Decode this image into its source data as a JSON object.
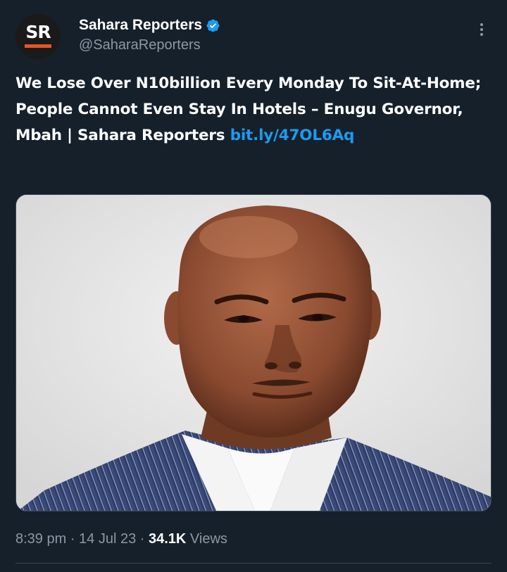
{
  "account": {
    "avatar_text": "SR",
    "display_name": "Sahara Reporters",
    "handle": "@SaharaReporters",
    "verified_icon": "verified-badge-icon",
    "verified_color": "#1d9bf0"
  },
  "tweet": {
    "text": "We Lose Over N10billion Every Monday To Sit-At-Home; People Cannot Even Stay In Hotels – Enugu Governor, Mbah  | Sahara Reporters ",
    "link": "bit.ly/47OL6Aq",
    "media_icon": "photo-portrait"
  },
  "meta": {
    "time": "8:39 pm",
    "separator": " · ",
    "date": "14 Jul 23",
    "views_count": "34.1K",
    "views_label": " Views"
  },
  "colors": {
    "background": "#15202b",
    "link": "#1d9bf0",
    "secondary_text": "#8b98a5",
    "brand_bar": "#e8542a"
  }
}
